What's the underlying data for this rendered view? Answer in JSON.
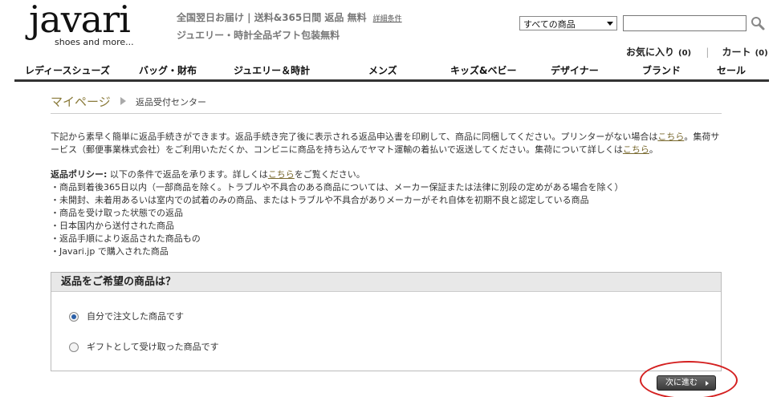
{
  "header": {
    "logo_word": "javari",
    "logo_tag": "shoes and more...",
    "promo_line1": "全国翌日お届け | 送料&365日間 返品 無料",
    "promo_detail": "詳細条件",
    "promo_line2": "ジュエリー・時計全品ギフト包装無料",
    "search_category": "すべての商品",
    "search_value": "",
    "favorites_label": "お気に入り",
    "favorites_count": "(0)",
    "cart_label": "カート",
    "cart_count": "(0)"
  },
  "nav": [
    "レディースシューズ",
    "バッグ・財布",
    "ジュエリー＆時計",
    "メンズ",
    "キッズ&ベビー",
    "デザイナー",
    "ブランド",
    "セール"
  ],
  "breadcrumb": {
    "home": "マイページ",
    "current": "返品受付センター"
  },
  "intro": {
    "t1": "下記から素早く簡単に返品手続きができます。返品手続き完了後に表示される返品申込書を印刷して、商品に同梱してください。プリンターがない場合は",
    "link1": "こちら",
    "t2": "。集荷サービス（郵便事業株式会社）をご利用いただくか、コンビニに商品を持ち込んでヤマト運輸の着払いで返送してください。集荷について詳しくは",
    "link2": "こちら",
    "t3": "。"
  },
  "policy": {
    "heading": "返品ポリシー:",
    "t1": " 以下の条件で返品を承ります。詳しくは",
    "link": "こちら",
    "t2": "をご覧ください。",
    "items": [
      "・商品到着後365日以内（一部商品を除く。トラブルや不具合のある商品については、メーカー保証または法律に別段の定めがある場合を除く）",
      "・未開封、未着用あるいは室内での試着のみの商品、またはトラブルや不具合がありメーカーがそれ自体を初期不良と認定している商品",
      "・商品を受け取った状態での返品",
      "・日本国内から送付された商品",
      "・返品手順により返品された商品もの",
      "・Javari.jp で購入された商品"
    ]
  },
  "return_box": {
    "title": "返品をご希望の商品は？",
    "option1": "自分で注文した商品です",
    "option2": "ギフトとして受け取った商品です",
    "selected": "option1"
  },
  "next_button": "次に進む",
  "colors": {
    "accent_link": "#7a6a30",
    "highlight_ring": "#d42020"
  }
}
